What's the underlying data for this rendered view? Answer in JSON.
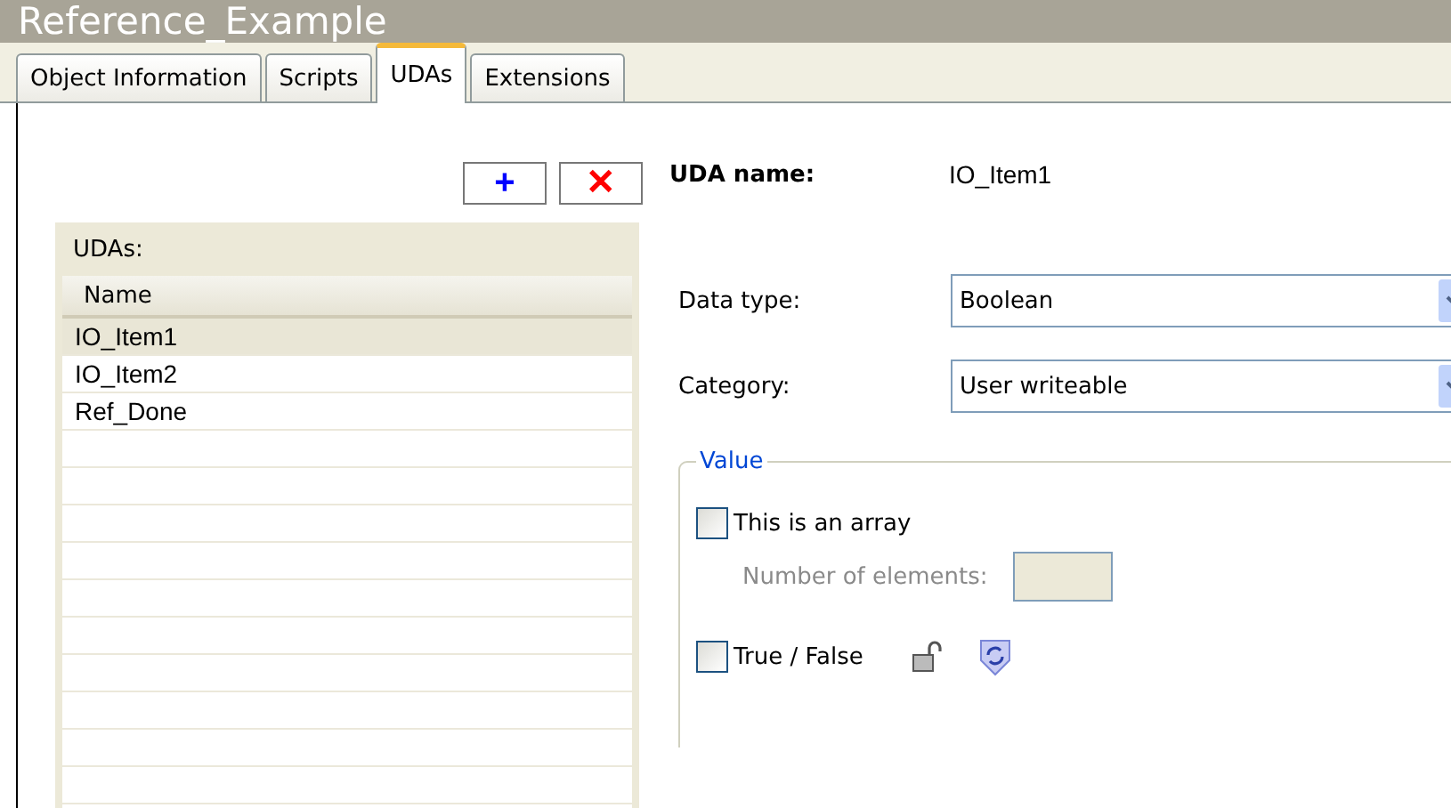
{
  "window": {
    "title": "Reference_Example"
  },
  "tabs": [
    {
      "label": "Object Information",
      "selected": false
    },
    {
      "label": "Scripts",
      "selected": false
    },
    {
      "label": "UDAs",
      "selected": true
    },
    {
      "label": "Extensions",
      "selected": false
    }
  ],
  "toolbar": {
    "add": "+",
    "delete": "✕"
  },
  "uda_list": {
    "label": "UDAs:",
    "column": "Name",
    "rows": [
      {
        "name": "IO_Item1",
        "selected": true
      },
      {
        "name": "IO_Item2",
        "selected": false
      },
      {
        "name": "Ref_Done",
        "selected": false
      }
    ]
  },
  "details": {
    "uda_name_label": "UDA name:",
    "uda_name": "IO_Item1",
    "data_type": {
      "label": "Data type:",
      "value": "Boolean"
    },
    "category": {
      "label": "Category:",
      "value": "User writeable"
    },
    "value_group": {
      "title": "Value",
      "array": {
        "label": "This is an array",
        "checked": false
      },
      "elements": {
        "label": "Number of elements:",
        "disabled": true
      },
      "true_false": {
        "label": "True / False",
        "checked": false
      }
    }
  }
}
